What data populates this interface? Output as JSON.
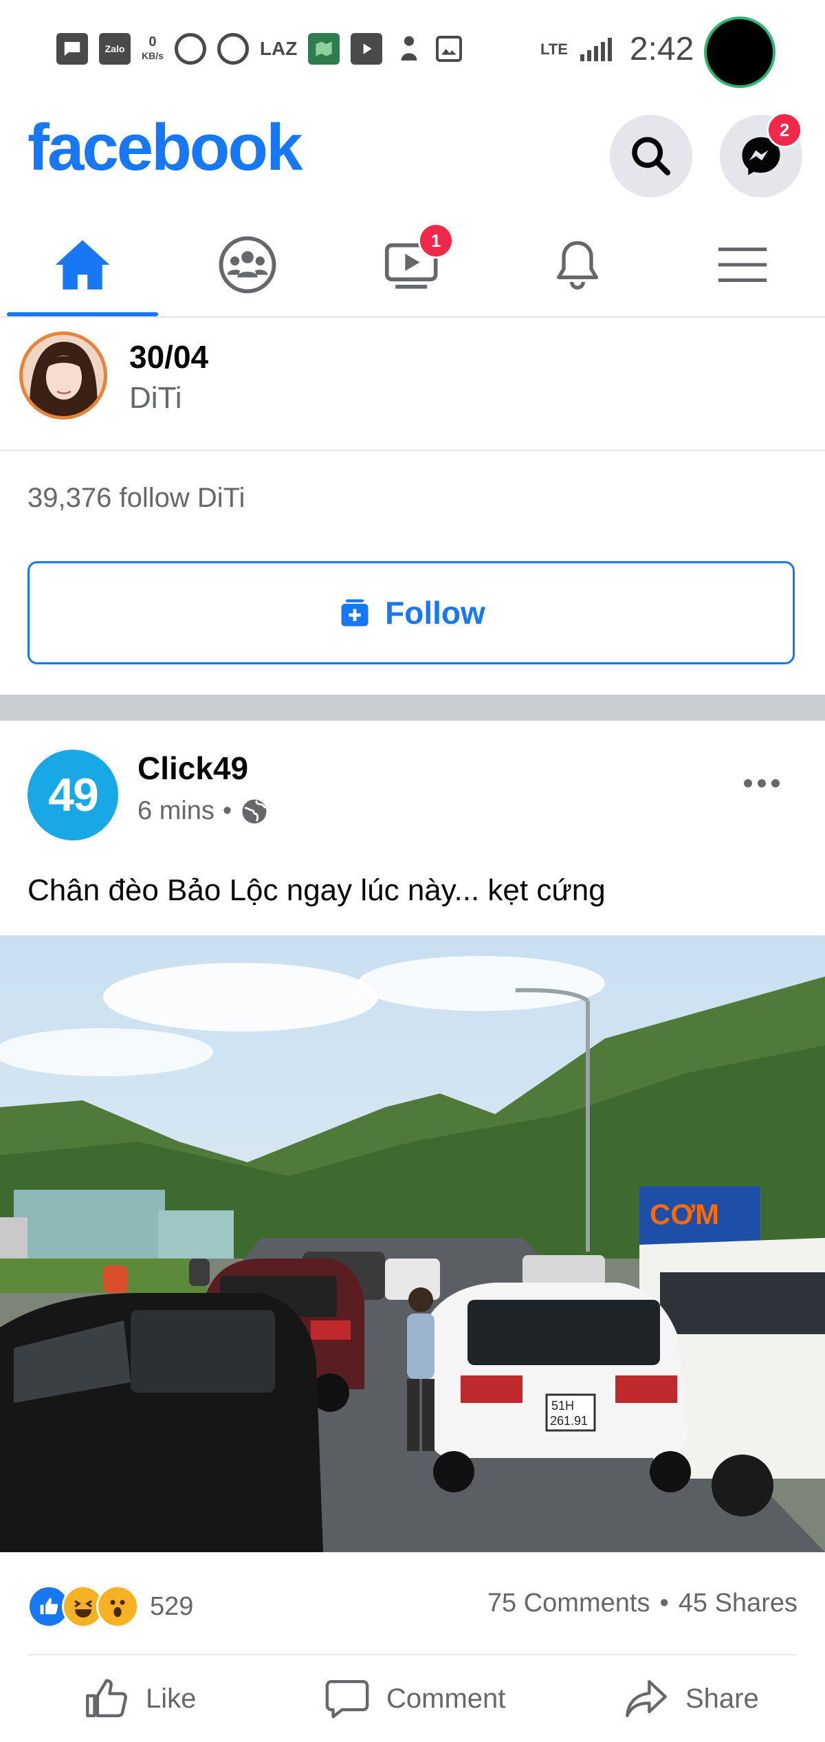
{
  "status_bar": {
    "app_icons": [
      "message-icon",
      "Zalo",
      "0 KB/s",
      "circle-icon",
      "circle-icon",
      "LAZ",
      "map-icon",
      "youtube-icon",
      "person-icon",
      "image-icon"
    ],
    "zalo_label": "Zalo",
    "speed_value": "0",
    "speed_unit": "KB/s",
    "laz_label": "LAZ",
    "network": "LTE",
    "time": "2:42"
  },
  "header": {
    "logo": "facebook",
    "messenger_badge": "2"
  },
  "nav": {
    "tabs": [
      {
        "name": "home",
        "active": true
      },
      {
        "name": "groups",
        "active": false
      },
      {
        "name": "watch",
        "active": false,
        "badge": "1"
      },
      {
        "name": "notifications",
        "active": false
      },
      {
        "name": "menu",
        "active": false
      }
    ]
  },
  "follow_card": {
    "title": "30/04",
    "page_name": "DiTi",
    "follow_count_text": "39,376 follow DiTi",
    "follow_button_label": "Follow"
  },
  "post": {
    "author": "Click49",
    "avatar_text": "49",
    "time": "6 mins",
    "separator": "•",
    "text": "Chân đèo Bảo Lộc ngay lúc này... kẹt cứng",
    "image_signs": {
      "restaurant_sign": "CƠM",
      "plate_top": "51H",
      "plate_bottom": "261.91"
    },
    "reactions": {
      "icons": [
        "like",
        "haha",
        "wow"
      ],
      "count": "529"
    },
    "comments": "75 Comments",
    "shares": "45 Shares",
    "actions": {
      "like": "Like",
      "comment": "Comment",
      "share": "Share"
    }
  },
  "colors": {
    "brand_blue": "#1877f2",
    "badge_red": "#f02849",
    "secondary_text": "#65676b",
    "click49_blue": "#18a8e6"
  }
}
